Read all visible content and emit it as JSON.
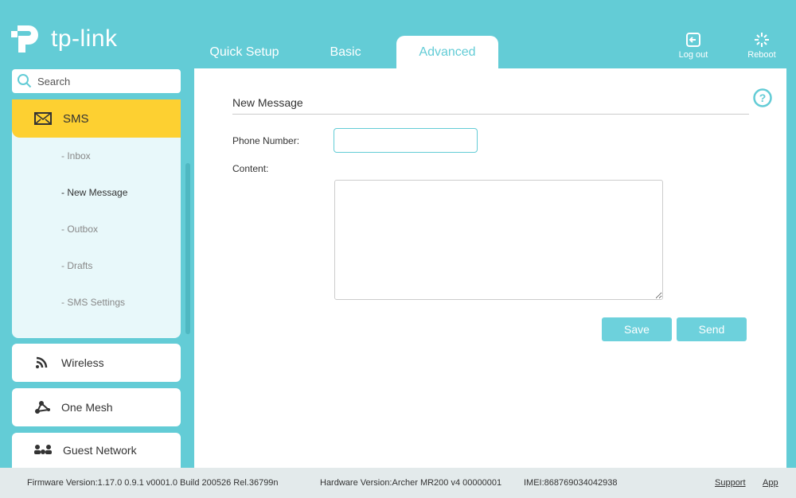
{
  "header": {
    "brand": "tp-link",
    "tabs": [
      "Quick Setup",
      "Basic",
      "Advanced"
    ],
    "active_tab": "Advanced",
    "logout": "Log out",
    "reboot": "Reboot"
  },
  "sidebar": {
    "search_placeholder": "Search",
    "sms": {
      "label": "SMS",
      "items": [
        "- Inbox",
        "- New Message",
        "- Outbox",
        "- Drafts",
        "- SMS Settings"
      ],
      "active": "- New Message"
    },
    "items": [
      "Wireless",
      "One Mesh",
      "Guest Network"
    ]
  },
  "main": {
    "title": "New Message",
    "phone_label": "Phone Number:",
    "phone_value": "",
    "content_label": "Content:",
    "content_value": "",
    "save": "Save",
    "send": "Send"
  },
  "footer": {
    "firmware": "Firmware Version:1.17.0 0.9.1 v0001.0 Build 200526 Rel.36799n",
    "hardware": "Hardware Version:Archer MR200 v4 00000001",
    "imei": "IMEI:868769034042938",
    "support": "Support",
    "app": "App"
  },
  "colors": {
    "accent": "#63ccd6",
    "active": "#fdd031"
  }
}
